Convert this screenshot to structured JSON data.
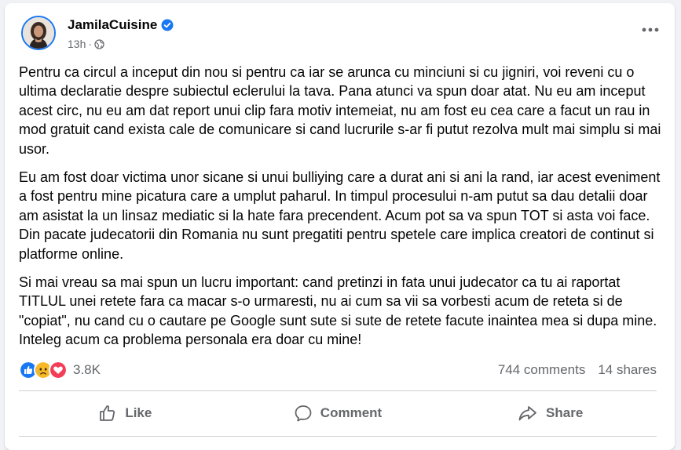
{
  "post": {
    "author": "JamilaCuisine",
    "time": "13h",
    "separator": "·",
    "paragraphs": [
      "Pentru ca circul a inceput din nou si pentru ca iar se arunca cu minciuni si cu jigniri, voi reveni cu o ultima declaratie despre subiectul eclerului la tava. Pana atunci va spun doar atat. Nu eu am inceput acest circ, nu eu am dat report unui clip fara motiv intemeiat, nu am fost eu cea care a facut un rau in mod gratuit cand exista cale de comunicare si cand lucrurile s-ar fi putut rezolva mult mai simplu si mai usor.",
      "Eu am fost doar victima unor sicane si unui bulliying care a durat ani si ani la rand, iar acest eveniment a fost pentru mine picatura care a umplut paharul. In timpul procesului n-am putut sa dau detalii doar am asistat la un linsaz mediatic si la hate fara precendent. Acum pot sa va spun TOT si asta voi face. Din pacate judecatorii din Romania nu sunt pregatiti pentru spetele care implica creatori de continut si platforme online.",
      "Si mai vreau sa mai spun un lucru important: cand pretinzi in fata unui judecator ca tu ai raportat TITLUL unei retete fara ca macar s-o urmaresti, nu ai cum sa vii sa vorbesti acum de reteta si de \"copiat\", nu cand cu o cautare pe Google sunt sute si sute de retete facute inaintea mea si dupa mine. Inteleg acum ca problema personala era doar cu mine!"
    ],
    "reaction_count": "3.8K",
    "reactions": [
      "like-icon",
      "sad-icon",
      "love-icon"
    ],
    "comments": "744 comments",
    "shares": "14 shares"
  },
  "actions": {
    "like": "Like",
    "comment": "Comment",
    "share": "Share"
  },
  "colors": {
    "accent": "#1877f2",
    "secondary_text": "#65676b",
    "background": "#f0f2f5",
    "like": "#1877f2",
    "sad": "#f7b928",
    "love": "#f33e58"
  }
}
